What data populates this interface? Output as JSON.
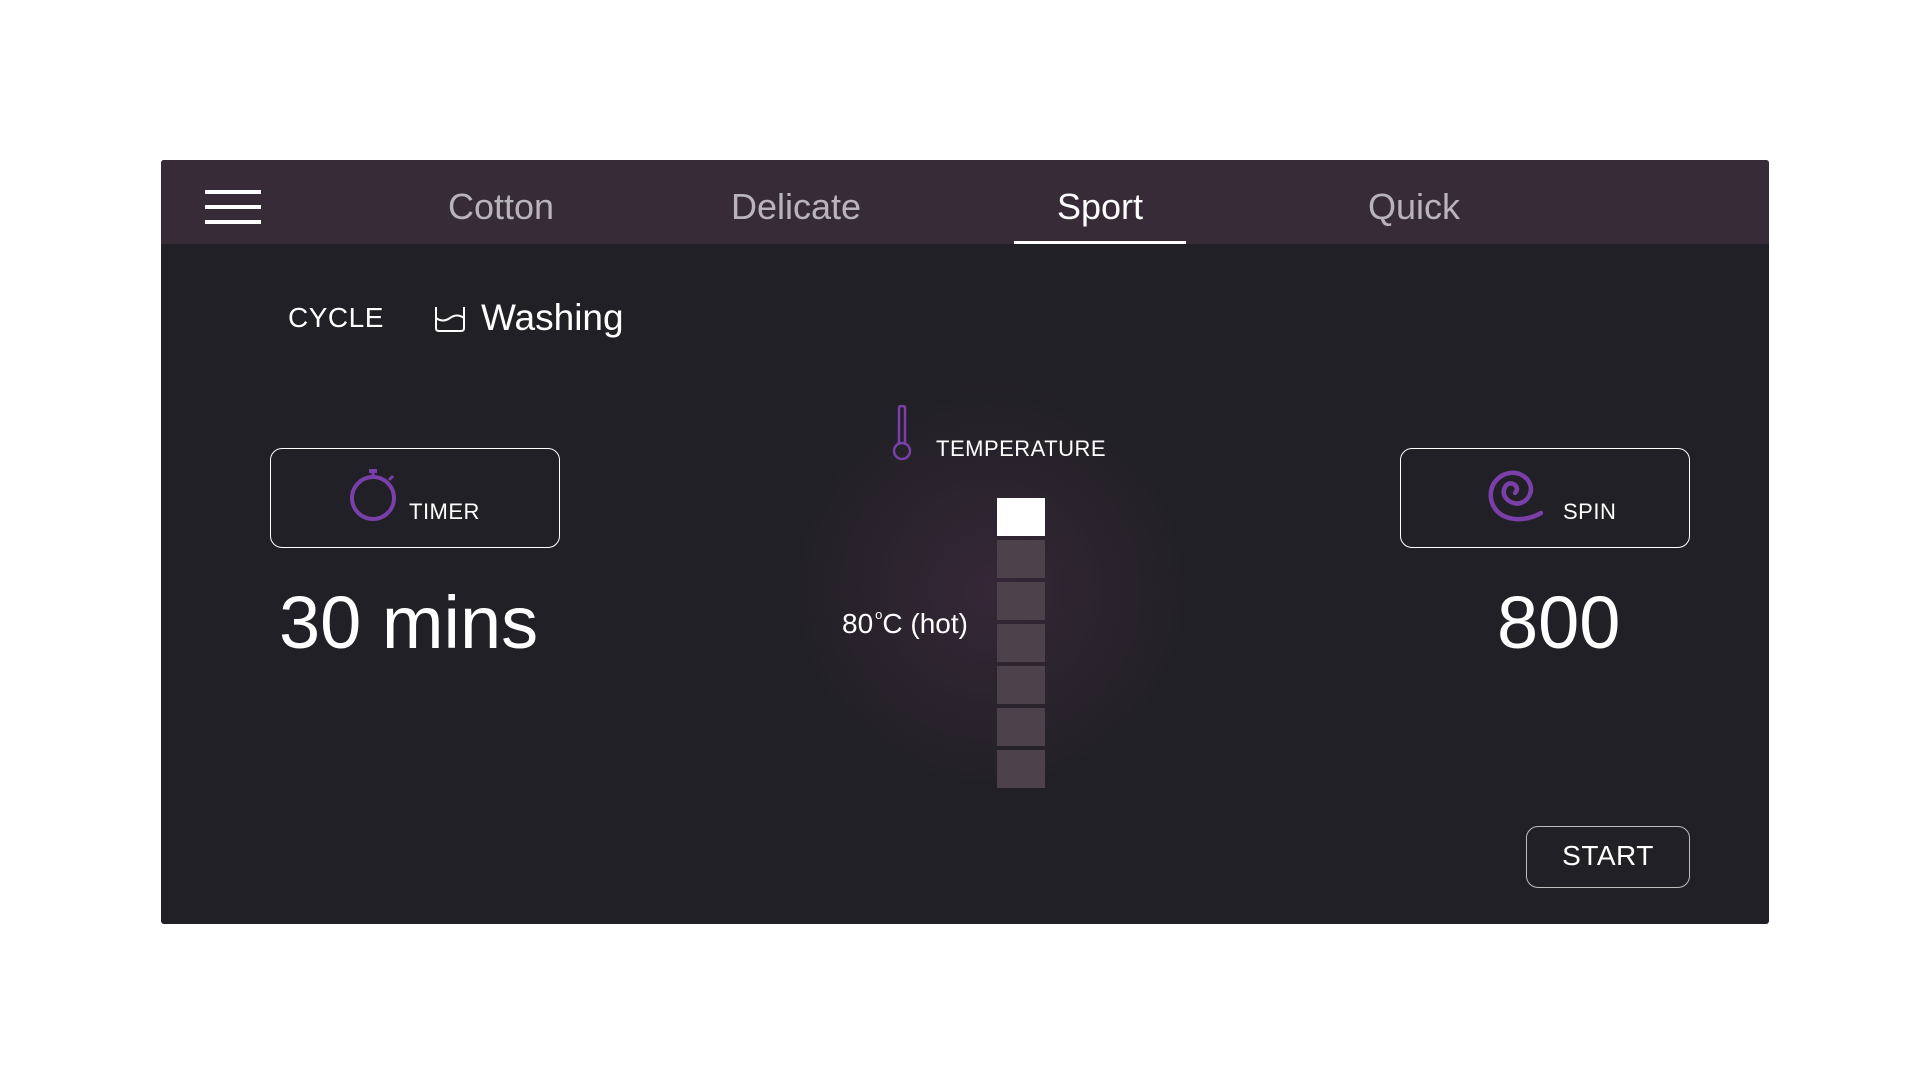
{
  "tabs": [
    {
      "label": "Cotton",
      "active": false
    },
    {
      "label": "Delicate",
      "active": false
    },
    {
      "label": "Sport",
      "active": true
    },
    {
      "label": "Quick",
      "active": false
    }
  ],
  "cycle": {
    "label": "CYCLE",
    "value": "Washing",
    "icon": "basin-icon"
  },
  "timer": {
    "label": "TIMER",
    "value": "30 mins",
    "icon": "stopwatch-icon"
  },
  "temperature": {
    "label": "TEMPERATURE",
    "value_number": "80",
    "value_degree": "o",
    "value_suffix": "C (hot)",
    "icon": "thermometer-icon",
    "levels_total": 7,
    "levels_selected": 1
  },
  "spin": {
    "label": "SPIN",
    "value": "800",
    "icon": "spiral-icon"
  },
  "start": {
    "label": "START"
  },
  "colors": {
    "panel": "#212026",
    "topbar": "#382b38",
    "accent": "#7a3fa8",
    "level_off": "#4d414c",
    "level_on": "#ffffff"
  }
}
